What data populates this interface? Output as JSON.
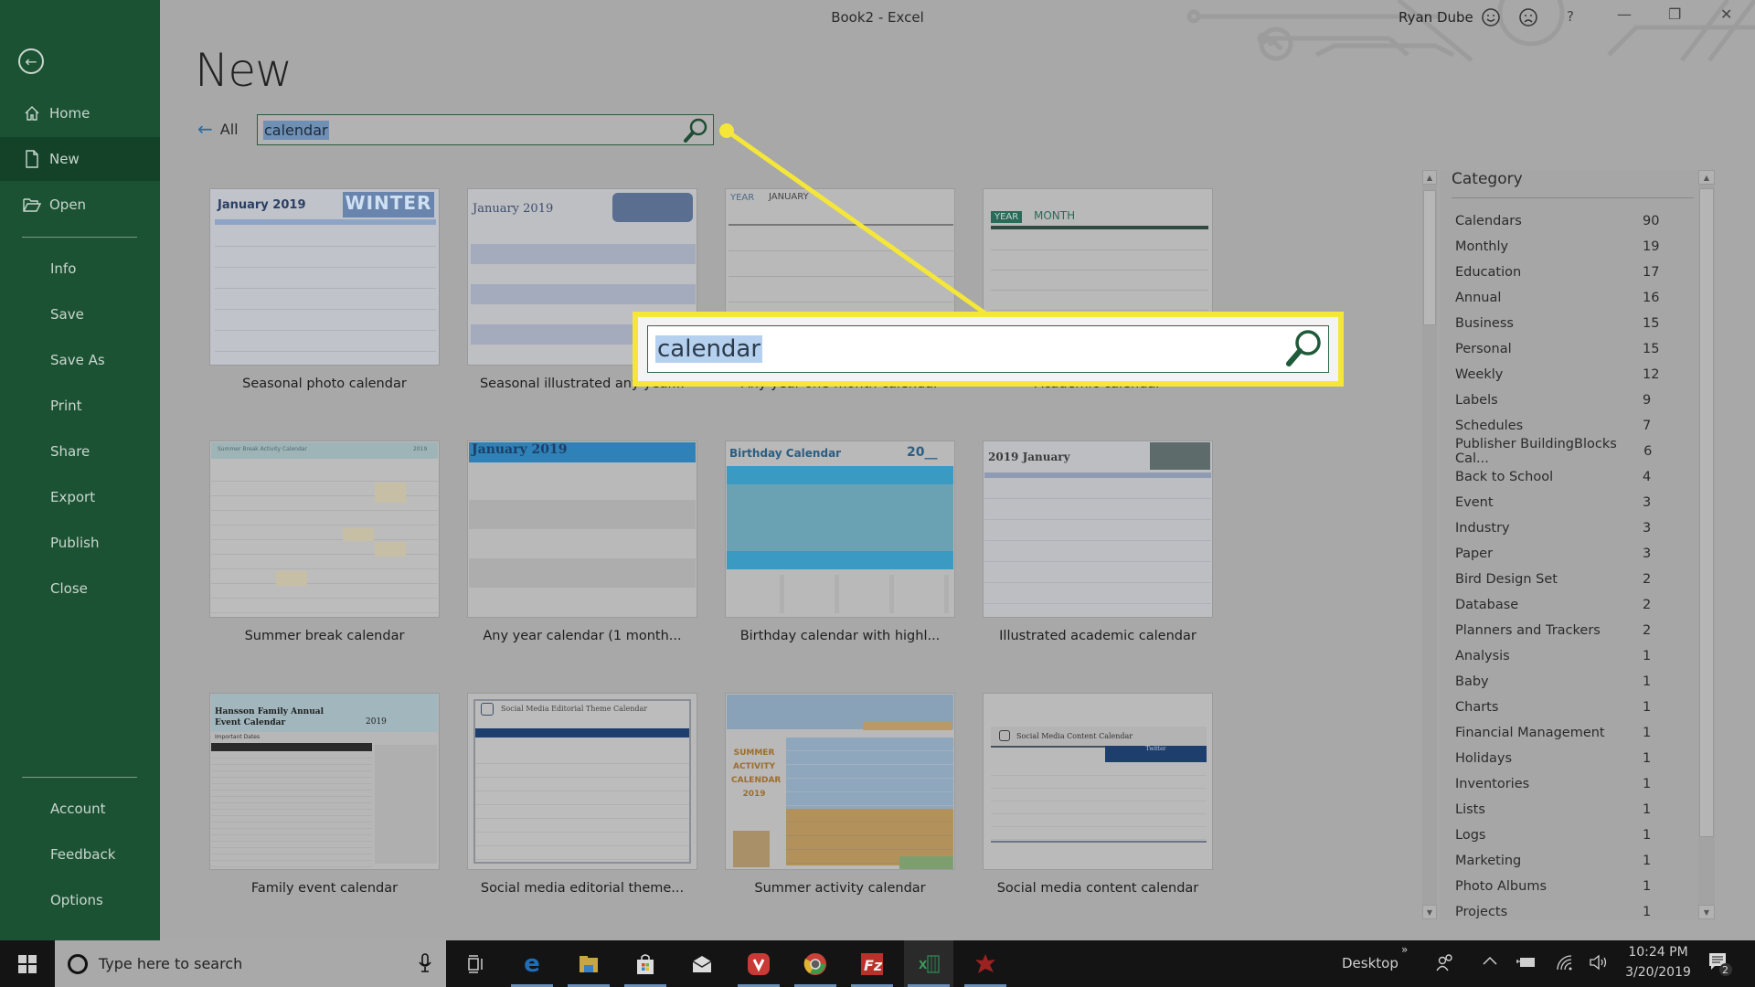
{
  "window": {
    "title": "Book2  -  Excel",
    "user_name": "Ryan Dube",
    "smile_icon": "smile-icon",
    "frown_icon": "frown-icon",
    "help_label": "?",
    "minimize_label": "—",
    "restore_label": "❐",
    "close_label": "✕"
  },
  "sidebar": {
    "back_icon": "back-arrow-icon",
    "items": [
      {
        "label": "Home",
        "icon": "home-icon"
      },
      {
        "label": "New",
        "icon": "new-document-icon",
        "active": true
      },
      {
        "label": "Open",
        "icon": "folder-open-icon"
      },
      {
        "label": "Info"
      },
      {
        "label": "Save"
      },
      {
        "label": "Save As"
      },
      {
        "label": "Print"
      },
      {
        "label": "Share"
      },
      {
        "label": "Export"
      },
      {
        "label": "Publish"
      },
      {
        "label": "Close"
      },
      {
        "label": "Account"
      },
      {
        "label": "Feedback"
      },
      {
        "label": "Options"
      }
    ]
  },
  "main": {
    "page_title": "New",
    "all_link": "All",
    "search": {
      "value": "calendar",
      "icon": "search-icon"
    },
    "callout": {
      "value": "calendar",
      "highlight_color": "#f5e63a"
    }
  },
  "templates": [
    {
      "name": "Seasonal photo calendar",
      "preview_title": "January 2019",
      "preview_banner": "WINTER"
    },
    {
      "name": "Seasonal illustrated any year...",
      "preview_title": "January 2019"
    },
    {
      "name": "Any year one-month calendar",
      "preview_title": "JANUARY",
      "preview_sub": "YEAR"
    },
    {
      "name": "Academic calendar",
      "preview_title": "MONTH",
      "preview_sub": "YEAR"
    },
    {
      "name": "Summer break calendar",
      "preview_title": "Summer Break Activity Calendar",
      "preview_year": "2019"
    },
    {
      "name": "Any year calendar (1 month...",
      "preview_title": "January 2019"
    },
    {
      "name": "Birthday calendar with highl...",
      "preview_title": "Birthday Calendar",
      "preview_year": "20__"
    },
    {
      "name": "Illustrated academic calendar",
      "preview_title": "2019  January"
    },
    {
      "name": "Family event calendar",
      "preview_title": "Hansson Family Annual Event Calendar",
      "preview_year": "2019",
      "preview_sub": "Important Dates"
    },
    {
      "name": "Social media editorial theme...",
      "preview_title": "Social Media Editorial Theme Calendar"
    },
    {
      "name": "Summer activity calendar",
      "preview_title": "SUMMER ACTIVITY CALENDAR 2019"
    },
    {
      "name": "Social media content calendar",
      "preview_title": "Social Media Content Calendar",
      "preview_sub": "Twitter"
    }
  ],
  "category": {
    "header": "Category",
    "items": [
      {
        "label": "Calendars",
        "count": "90"
      },
      {
        "label": "Monthly",
        "count": "19"
      },
      {
        "label": "Education",
        "count": "17"
      },
      {
        "label": "Annual",
        "count": "16"
      },
      {
        "label": "Business",
        "count": "15"
      },
      {
        "label": "Personal",
        "count": "15"
      },
      {
        "label": "Weekly",
        "count": "12"
      },
      {
        "label": "Labels",
        "count": "9"
      },
      {
        "label": "Schedules",
        "count": "7"
      },
      {
        "label": "Publisher BuildingBlocks Cal...",
        "count": "6"
      },
      {
        "label": "Back to School",
        "count": "4"
      },
      {
        "label": "Event",
        "count": "3"
      },
      {
        "label": "Industry",
        "count": "3"
      },
      {
        "label": "Paper",
        "count": "3"
      },
      {
        "label": "Bird Design Set",
        "count": "2"
      },
      {
        "label": "Database",
        "count": "2"
      },
      {
        "label": "Planners and Trackers",
        "count": "2"
      },
      {
        "label": "Analysis",
        "count": "1"
      },
      {
        "label": "Baby",
        "count": "1"
      },
      {
        "label": "Charts",
        "count": "1"
      },
      {
        "label": "Financial Management",
        "count": "1"
      },
      {
        "label": "Holidays",
        "count": "1"
      },
      {
        "label": "Inventories",
        "count": "1"
      },
      {
        "label": "Lists",
        "count": "1"
      },
      {
        "label": "Logs",
        "count": "1"
      },
      {
        "label": "Marketing",
        "count": "1"
      },
      {
        "label": "Photo Albums",
        "count": "1"
      },
      {
        "label": "Projects",
        "count": "1"
      }
    ]
  },
  "taskbar": {
    "search_placeholder": "Type here to search",
    "apps": [
      "task-view",
      "edge",
      "file-explorer",
      "store",
      "mail",
      "vivaldi",
      "chrome",
      "filezilla",
      "excel",
      "app-red"
    ],
    "desktop_label": "Desktop",
    "time": "10:24 PM",
    "date": "3/20/2019",
    "notification_count": "2"
  }
}
